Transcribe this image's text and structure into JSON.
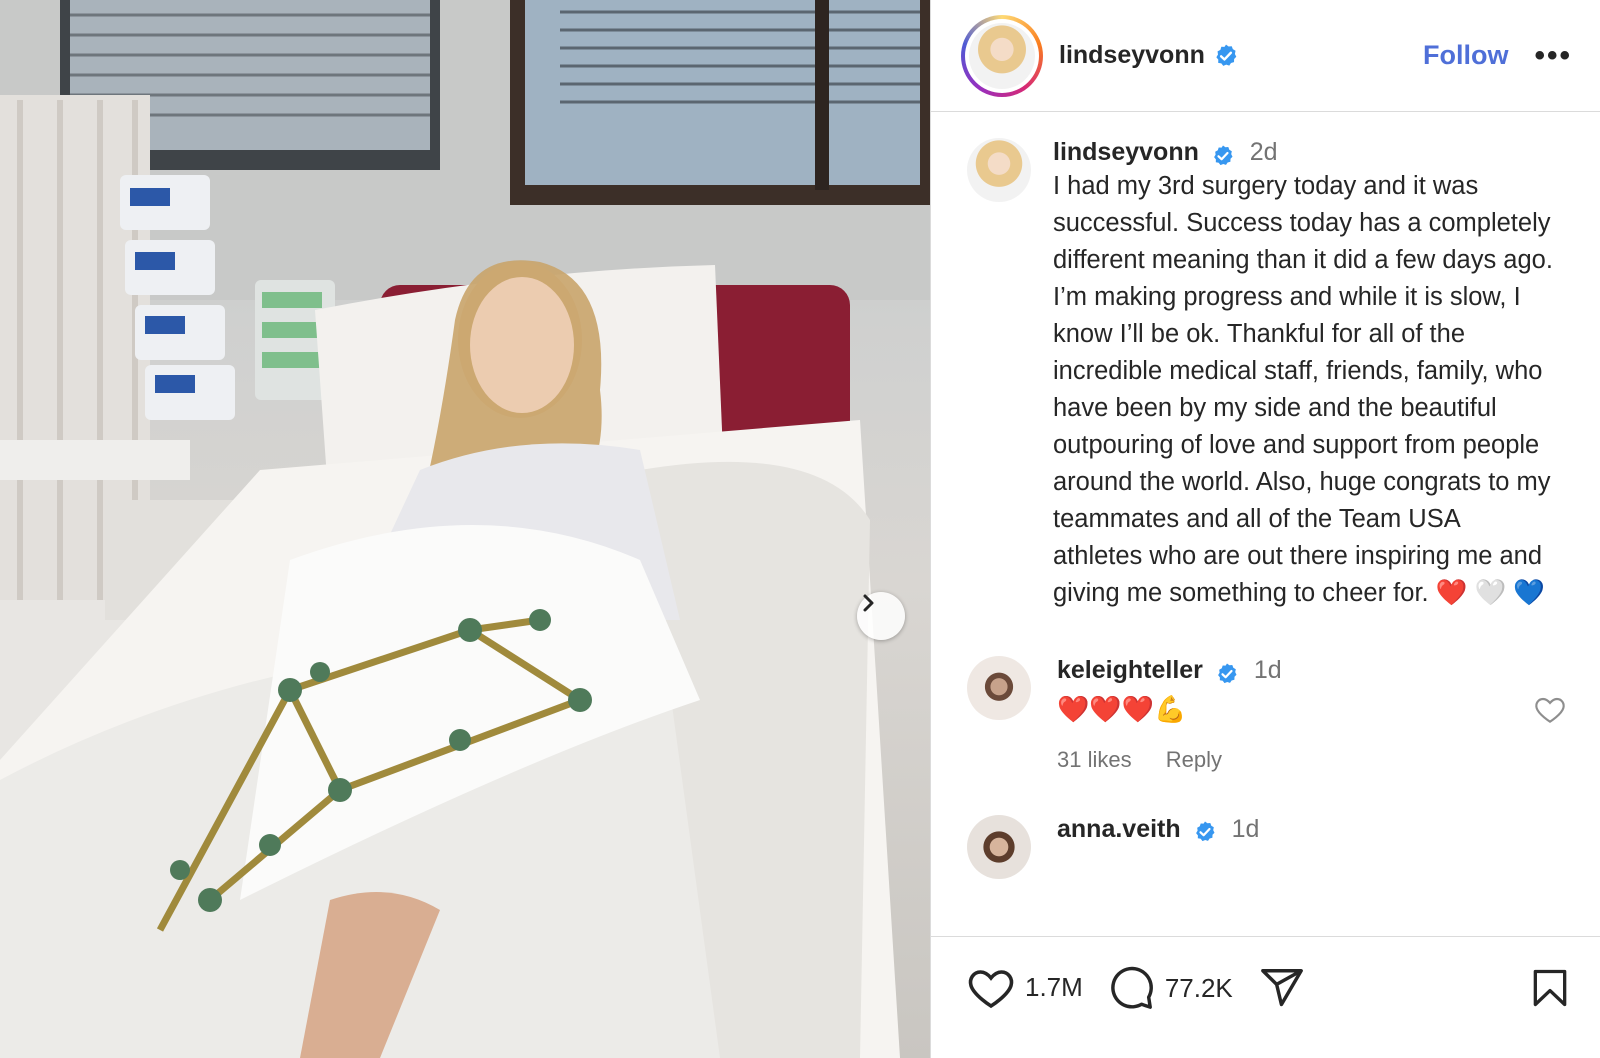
{
  "post": {
    "username": "lindseyvonn",
    "follow_label": "Follow",
    "more_label": "•••",
    "icons": {
      "next": "chevron-right-icon",
      "verified": "verified-badge-icon"
    },
    "caption": {
      "username": "lindseyvonn",
      "time": "2d",
      "text": "I had my 3rd surgery today and it was successful. Success today has a completely different meaning than it did a few days ago. I’m making progress and while it is slow, I know I’ll be ok. Thankful for all of the incredible medical staff, friends, family, who have been by my side and the beautiful outpouring of love and support from people around the world. Also, huge congrats to my teammates and all of the Team USA athletes who are out there inspiring me and giving me something to cheer for. ❤️ 🤍 💙"
    },
    "comments": [
      {
        "username": "keleighteller",
        "time": "1d",
        "text": "❤️❤️❤️💪",
        "likes": "31 likes",
        "reply": "Reply"
      },
      {
        "username": "anna.veith",
        "time": "1d"
      }
    ],
    "actions": {
      "likes_count": "1.7M",
      "comments_count": "77.2K"
    },
    "colors": {
      "accent": "#4f6fd8",
      "verified": "#3797f0",
      "text": "#262626",
      "muted": "#737373"
    }
  }
}
